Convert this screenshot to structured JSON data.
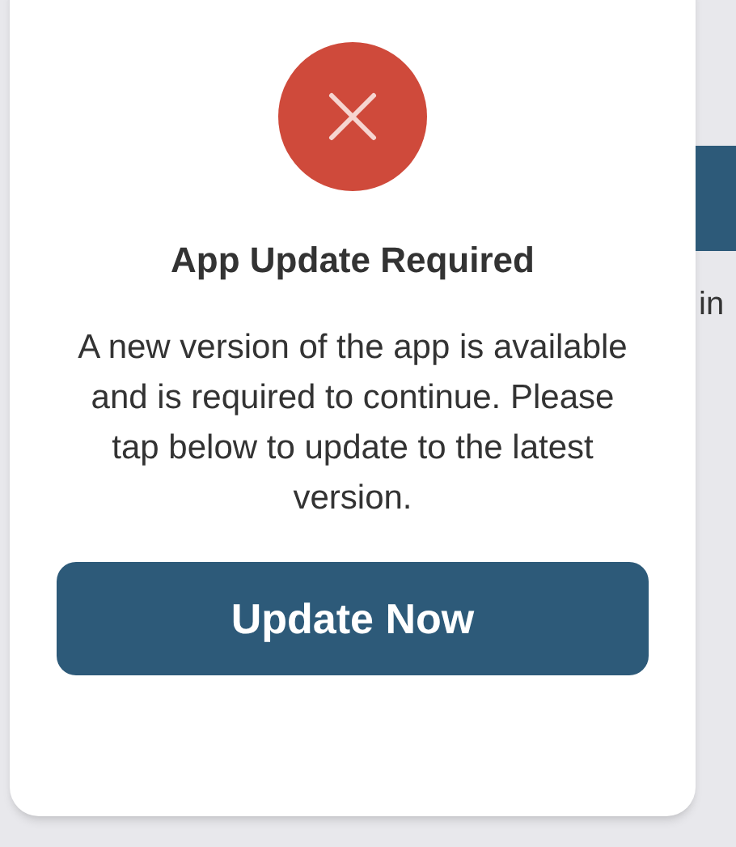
{
  "dialog": {
    "title": "App Update Required",
    "message": "A new version of the app is available and is required to continue. Please tap below to update to the latest version.",
    "button": "Update Now"
  },
  "background": {
    "text": "in"
  }
}
